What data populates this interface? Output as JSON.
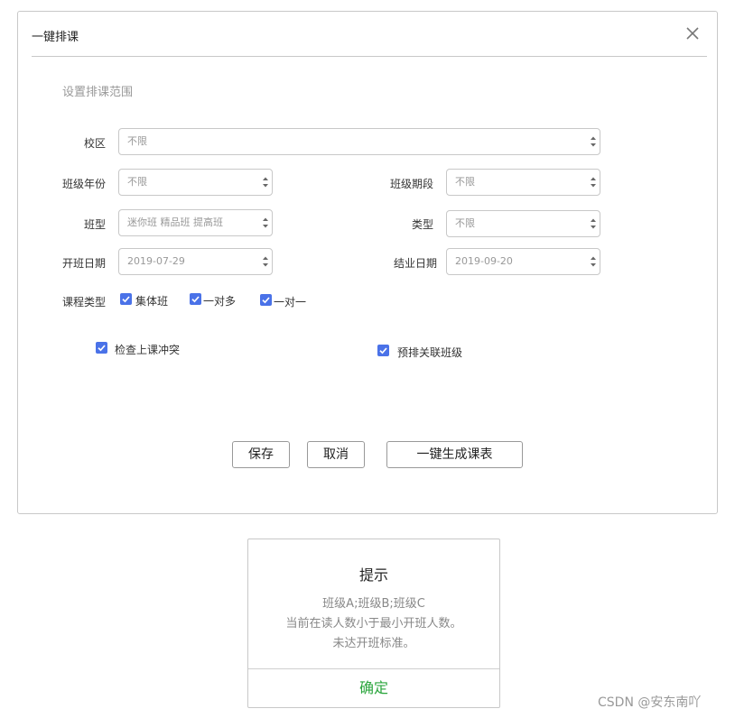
{
  "dialog": {
    "title": "一键排课",
    "section_title": "设置排课范围"
  },
  "form": {
    "campus": {
      "label": "校区",
      "value": "不限"
    },
    "grade_year": {
      "label": "班级年份",
      "value": "不限"
    },
    "class_period": {
      "label": "班级期段",
      "value": "不限"
    },
    "class_type": {
      "label": "班型",
      "value": "迷你班 精品班 提高班"
    },
    "category": {
      "label": "类型",
      "value": "不限"
    },
    "start_date": {
      "label": "开班日期",
      "value": "2019-07-29"
    },
    "end_date": {
      "label": "结业日期",
      "value": "2019-09-20"
    },
    "course_type": {
      "label": "课程类型",
      "options": [
        {
          "label": "集体班",
          "checked": true
        },
        {
          "label": "一对多",
          "checked": true
        },
        {
          "label": "一对一",
          "checked": true
        }
      ]
    },
    "check_conflict": {
      "label": "检查上课冲突",
      "checked": true
    },
    "prearrange_linked": {
      "label": "预排关联班级",
      "checked": true
    }
  },
  "buttons": {
    "save": "保存",
    "cancel": "取消",
    "generate": "一键生成课表"
  },
  "tip": {
    "title": "提示",
    "lines": [
      "班级A;班级B;班级C",
      "当前在读人数小于最小开班人数。",
      "未达开班标准。"
    ],
    "ok": "确定"
  },
  "watermark": "CSDN @安东南吖",
  "colors": {
    "checkbox": "#4a72e8",
    "ok_text": "#2aa53c"
  }
}
